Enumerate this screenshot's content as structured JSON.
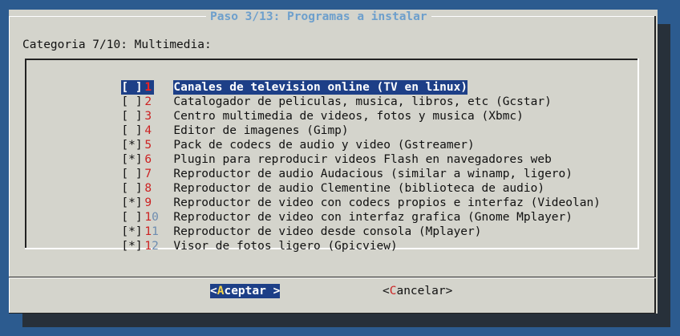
{
  "dialog": {
    "title": "Paso 3/13: Programas a instalar",
    "prompt": "Categoria 7/10: Multimedia:"
  },
  "items": [
    {
      "check": "[ ]",
      "num_a": "1",
      "num_b": "",
      "label": "Canales de television online (TV en linux)",
      "selected": true
    },
    {
      "check": "[ ]",
      "num_a": "2",
      "num_b": "",
      "label": "Catalogador de peliculas, musica, libros, etc (Gcstar)"
    },
    {
      "check": "[ ]",
      "num_a": "3",
      "num_b": "",
      "label": "Centro multimedia de videos, fotos y musica (Xbmc)"
    },
    {
      "check": "[ ]",
      "num_a": "4",
      "num_b": "",
      "label": "Editor de imagenes (Gimp)"
    },
    {
      "check": "[*]",
      "num_a": "5",
      "num_b": "",
      "label": "Pack de codecs de audio y video (Gstreamer)"
    },
    {
      "check": "[*]",
      "num_a": "6",
      "num_b": "",
      "label": "Plugin para reproducir videos Flash en navegadores web"
    },
    {
      "check": "[ ]",
      "num_a": "7",
      "num_b": "",
      "label": "Reproductor de audio Audacious (similar a winamp, ligero)"
    },
    {
      "check": "[ ]",
      "num_a": "8",
      "num_b": "",
      "label": "Reproductor de audio Clementine (biblioteca de audio)"
    },
    {
      "check": "[*]",
      "num_a": "9",
      "num_b": "",
      "label": "Reproductor de video con codecs propios e interfaz (Videolan)"
    },
    {
      "check": "[ ]",
      "num_a": "1",
      "num_b": "0",
      "label": "Reproductor de video con interfaz grafica (Gnome Mplayer)"
    },
    {
      "check": "[*]",
      "num_a": "1",
      "num_b": "1",
      "label": "Reproductor de video desde consola (Mplayer)"
    },
    {
      "check": "[*]",
      "num_a": "1",
      "num_b": "2",
      "label": "Visor de fotos ligero (Gpicview)"
    }
  ],
  "buttons": {
    "ok": {
      "open": "<",
      "hot": "A",
      "rest": "ceptar",
      "close": " >"
    },
    "cancel": {
      "open": "<",
      "hot": "C",
      "rest": "ancelar",
      "close": ">"
    }
  },
  "colors": {
    "background": "#2c5b8f",
    "dialog": "#d4d4cc",
    "title": "#6d9fcc",
    "selection": "#1d3f87",
    "hotkey": "#cc2222"
  }
}
